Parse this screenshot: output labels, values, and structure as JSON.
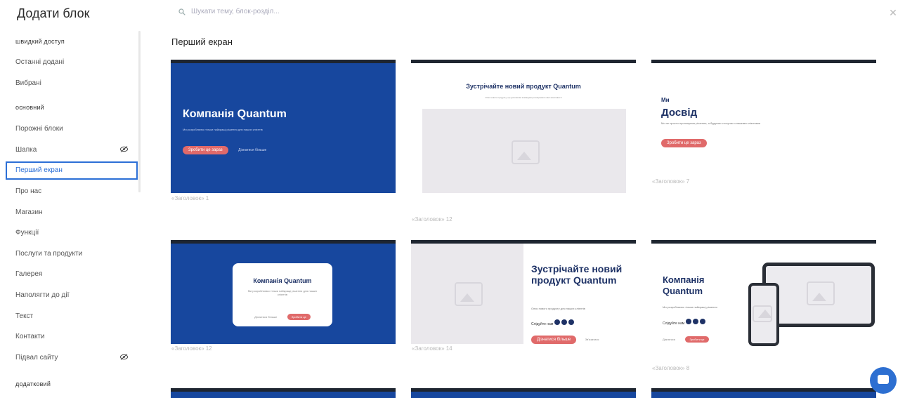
{
  "header": {
    "title": "Додати блок",
    "search_placeholder": "Шукати тему, блок-розділ..."
  },
  "sidebar": {
    "items": [
      {
        "label": "швидкий доступ",
        "type": "section"
      },
      {
        "label": "Останні додані",
        "type": "item"
      },
      {
        "label": "Вибрані",
        "type": "item"
      },
      {
        "label": "основний",
        "type": "section"
      },
      {
        "label": "Порожні блоки",
        "type": "item"
      },
      {
        "label": "Шапка",
        "type": "item",
        "icon": "eye-off-icon"
      },
      {
        "label": "Перший екран",
        "type": "item",
        "active": true
      },
      {
        "label": "Про нас",
        "type": "item"
      },
      {
        "label": "Магазин",
        "type": "item"
      },
      {
        "label": "Функції",
        "type": "item"
      },
      {
        "label": "Послуги та продукти",
        "type": "item"
      },
      {
        "label": "Галерея",
        "type": "item"
      },
      {
        "label": "Наполягти до дії",
        "type": "item"
      },
      {
        "label": "Текст",
        "type": "item"
      },
      {
        "label": "Контакти",
        "type": "item"
      },
      {
        "label": "Підвал сайту",
        "type": "item",
        "icon": "eye-off-icon"
      },
      {
        "label": "додатковий",
        "type": "section"
      }
    ]
  },
  "main": {
    "section_title": "Перший екран",
    "cards": [
      {
        "caption": "«Заголовок» 1",
        "heading": "Компанія Quantum",
        "text": "Ми розробляємо тільки найкращі рішення для наших клієнтів",
        "button": "Зробити це зараз",
        "link": "Дізнатися більше"
      },
      {
        "caption": "«Заголовок» 12",
        "heading": "Зустрічайте новий продукт Quantum",
        "text": "Опис нового продукту, що допомагає командам розширювати свої можливості"
      },
      {
        "caption": "«Заголовок» 7",
        "heading_small": "Ми",
        "heading": "Досвід",
        "text": "Ми не просто пропонуємо рішення, а будуємо стосунки з нашими клієнтами",
        "button": "Зробити це зараз"
      },
      {
        "caption": "«Заголовок» 12",
        "heading": "Компанія Quantum",
        "text": "Ми розробляємо тільки найкращі рішення для наших клієнтів",
        "link": "Дізнатися більше",
        "button": "Зробити це"
      },
      {
        "caption": "«Заголовок» 14",
        "heading": "Зустрічайте новий продукт Quantum",
        "text": "Опис нового продукту для наших клієнтів",
        "follow_label": "Слідуйте нам",
        "button": "Дізнатися більше",
        "link": "Зв'язатися"
      },
      {
        "caption": "«Заголовок» 8",
        "heading": "Компанія Quantum",
        "text": "Ми розробляємо тільки найкращі рішення",
        "follow_label": "Слідуйте нам",
        "link": "Дізнатися",
        "button": "Зробити це"
      }
    ]
  },
  "colors": {
    "accent": "#2c6fd6",
    "card_blue": "#17479e",
    "button_red": "#e06a6a",
    "chat": "#2d6fd1"
  }
}
